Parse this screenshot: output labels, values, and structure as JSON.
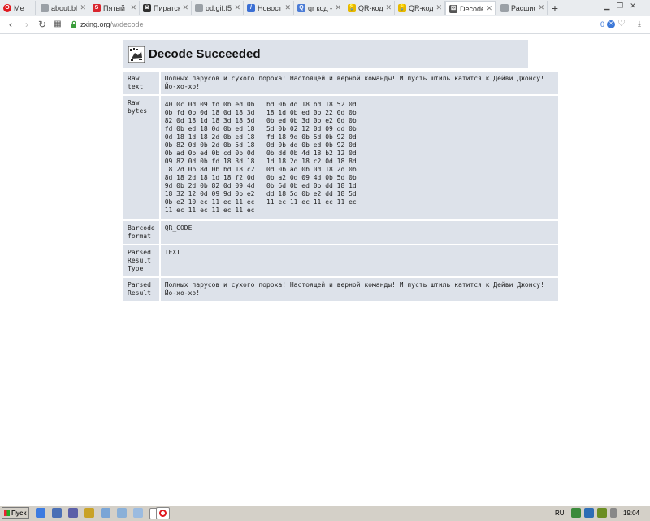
{
  "browser": {
    "tabs": [
      {
        "label": "Меню",
        "icon": "opera-icon",
        "color": "#e0191f"
      },
      {
        "label": "about:bla",
        "icon": "page-icon",
        "color": "#9aa0a6"
      },
      {
        "label": "Пятый к",
        "icon": "s-site-icon",
        "color": "#d9262e"
      },
      {
        "label": "Пиратск",
        "icon": "skull-icon",
        "color": "#2f2f2f"
      },
      {
        "label": "od.gif.f5",
        "icon": "page-icon",
        "color": "#9aa0a6"
      },
      {
        "label": "Новости",
        "icon": "news-icon",
        "color": "#3b6fd4"
      },
      {
        "label": "qr код —",
        "icon": "search-icon",
        "color": "#4a7bd6"
      },
      {
        "label": "QR-коды",
        "icon": "bulb-icon",
        "color": "#e6b800"
      },
      {
        "label": "QR-коды",
        "icon": "bulb-icon",
        "color": "#e6b800"
      },
      {
        "label": "Decode S",
        "icon": "zxing-icon",
        "color": "#555555"
      },
      {
        "label": "Расшиф",
        "icon": "page-icon",
        "color": "#9aa0a6"
      }
    ],
    "new_tab": "+",
    "address": {
      "host": "zxing.org",
      "path": "/w/decode",
      "badge": "0"
    }
  },
  "page": {
    "title": "Decode Succeeded",
    "rows": {
      "raw_text": {
        "label_lines": [
          "Raw",
          "text"
        ],
        "value": "Полных парусов и сухого пороха! Настоящей и верной команды! И пусть штиль катится к Дейви Джонсу! Йо-хо-хо!"
      },
      "raw_bytes": {
        "label_lines": [
          "Raw",
          "bytes"
        ],
        "lines": [
          "40 0c 0d 09 fd 0b ed 0b   bd 0b dd 18 bd 18 52 0d",
          "0b fd 0b 0d 18 0d 18 3d   18 1d 0b ed 0b 22 0d 0b",
          "82 0d 18 1d 18 3d 18 5d   0b ed 0b 3d 0b e2 0d 0b",
          "fd 0b ed 18 0d 0b ed 18   5d 0b 02 12 0d 09 dd 0b",
          "0d 18 1d 18 2d 0b ed 18   fd 18 9d 0b 5d 0b 92 0d",
          "0b 82 0d 0b 2d 0b 5d 18   0d 0b dd 0b ed 0b 92 0d",
          "0b ad 0b ed 0b cd 0b 0d   0b dd 0b 4d 18 b2 12 0d",
          "09 82 0d 0b fd 18 3d 18   1d 18 2d 18 c2 0d 18 8d",
          "18 2d 0b 8d 0b bd 18 c2   0d 0b ad 0b 0d 18 2d 0b",
          "8d 18 2d 18 1d 18 f2 0d   0b a2 0d 09 4d 0b 5d 0b",
          "9d 0b 2d 0b 82 0d 09 4d   0b 6d 0b ed 0b dd 18 1d",
          "18 32 12 0d 09 9d 0b e2   dd 18 5d 0b e2 dd 18 5d",
          "0b e2 10 ec 11 ec 11 ec   11 ec 11 ec 11 ec 11 ec",
          "11 ec 11 ec 11 ec 11 ec"
        ]
      },
      "barcode_format": {
        "label_lines": [
          "Barcode",
          "format"
        ],
        "value": "QR_CODE"
      },
      "parsed_result_type": {
        "label_lines": [
          "Parsed",
          "Result",
          "Type"
        ],
        "value": "TEXT"
      },
      "parsed_result": {
        "label_lines": [
          "Parsed",
          "Result"
        ],
        "value": "Полных парусов и сухого пороха! Настоящей и верной команды! И пусть штиль катится к Дейви Джонсу! Йо-хо-хо!"
      }
    }
  },
  "taskbar": {
    "start_label": "Пуск",
    "language": "RU",
    "clock": "19:04"
  }
}
